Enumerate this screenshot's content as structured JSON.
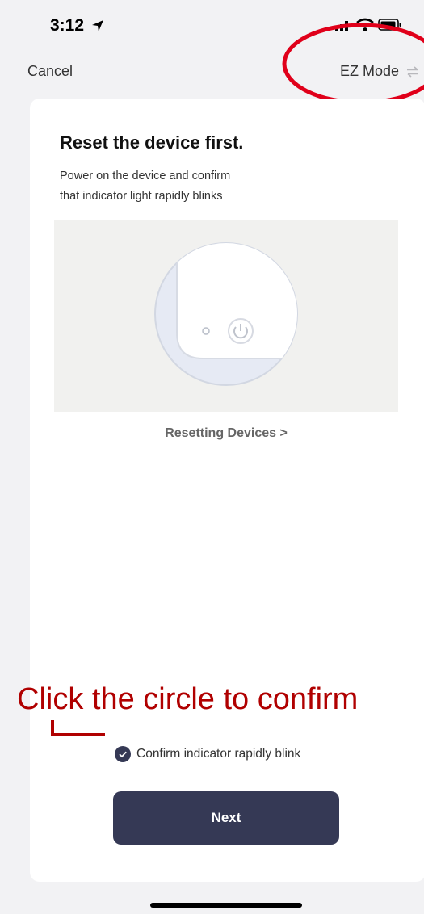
{
  "status_bar": {
    "time": "3:12"
  },
  "nav": {
    "cancel_label": "Cancel",
    "mode_label": "EZ Mode"
  },
  "card": {
    "title": "Reset the device first.",
    "description_line1": "Power on the device and confirm",
    "description_line2": "that indicator light rapidly blinks",
    "resetting_link": "Resetting Devices >"
  },
  "annotation": {
    "text": "Click the circle to confirm"
  },
  "confirm": {
    "label": "Confirm indicator rapidly blink",
    "checked": true
  },
  "next_button": {
    "label": "Next"
  },
  "colors": {
    "primary": "#353955",
    "annotation_red": "#b00000",
    "highlight_red": "#e0001a",
    "background": "#f2f2f4",
    "card": "#ffffff"
  }
}
